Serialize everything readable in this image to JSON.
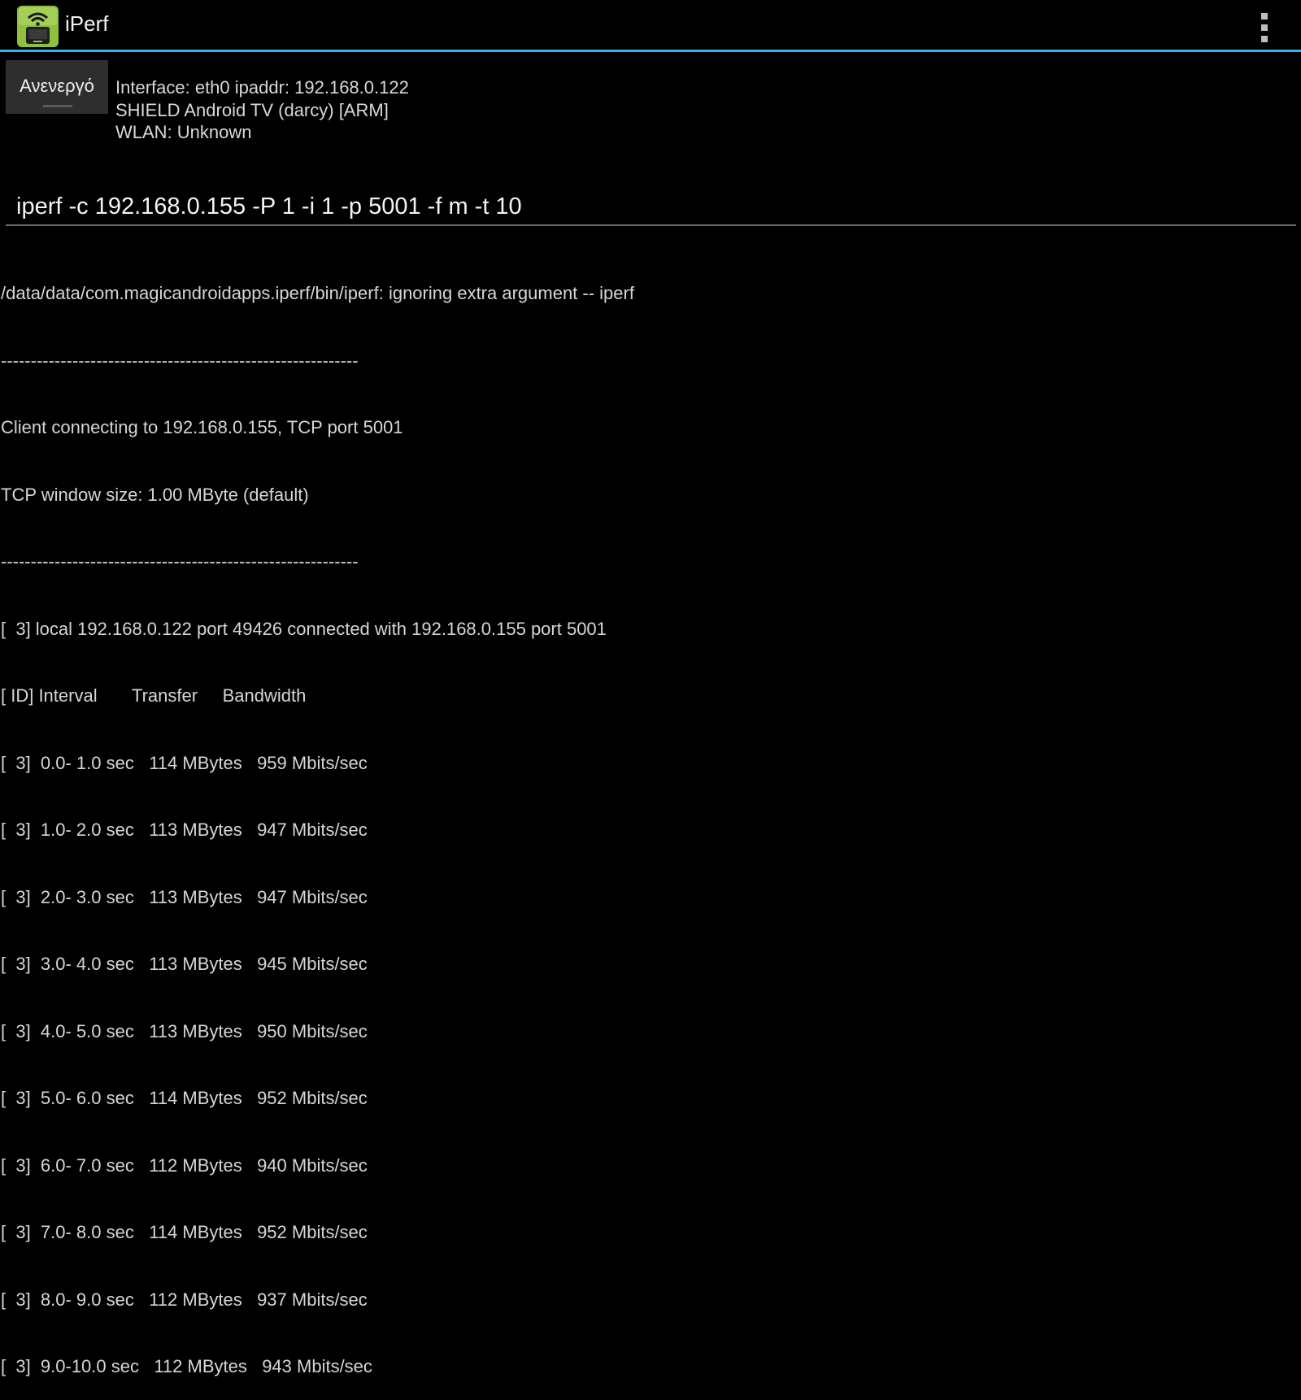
{
  "action_bar": {
    "title": "iPerf",
    "icon": "wifi-android-tv-icon",
    "menu_icon": "overflow-menu-icon"
  },
  "colors": {
    "accent": "#33b5e5",
    "icon_green": "#8fc13e",
    "background": "#000000"
  },
  "toggle": {
    "label": "Ανενεργό"
  },
  "info": {
    "interface": "Interface: eth0 ipaddr: 192.168.0.122",
    "device": "SHIELD Android TV (darcy) [ARM]",
    "wlan": "WLAN: Unknown"
  },
  "command": {
    "value": "iperf -c 192.168.0.155 -P 1 -i 1 -p 5001 -f m -t 10"
  },
  "output": {
    "lines": [
      "/data/data/com.magicandroidapps.iperf/bin/iperf: ignoring extra argument -- iperf",
      "------------------------------------------------------------",
      "Client connecting to 192.168.0.155, TCP port 5001",
      "TCP window size: 1.00 MByte (default)",
      "------------------------------------------------------------",
      "[  3] local 192.168.0.122 port 49426 connected with 192.168.0.155 port 5001",
      "[ ID] Interval       Transfer     Bandwidth",
      "[  3]  0.0- 1.0 sec   114 MBytes   959 Mbits/sec",
      "[  3]  1.0- 2.0 sec   113 MBytes   947 Mbits/sec",
      "[  3]  2.0- 3.0 sec   113 MBytes   947 Mbits/sec",
      "[  3]  3.0- 4.0 sec   113 MBytes   945 Mbits/sec",
      "[  3]  4.0- 5.0 sec   113 MBytes   950 Mbits/sec",
      "[  3]  5.0- 6.0 sec   114 MBytes   952 Mbits/sec",
      "[  3]  6.0- 7.0 sec   112 MBytes   940 Mbits/sec",
      "[  3]  7.0- 8.0 sec   114 MBytes   952 Mbits/sec",
      "[  3]  8.0- 9.0 sec   112 MBytes   937 Mbits/sec",
      "[  3]  9.0-10.0 sec   112 MBytes   943 Mbits/sec"
    ]
  }
}
